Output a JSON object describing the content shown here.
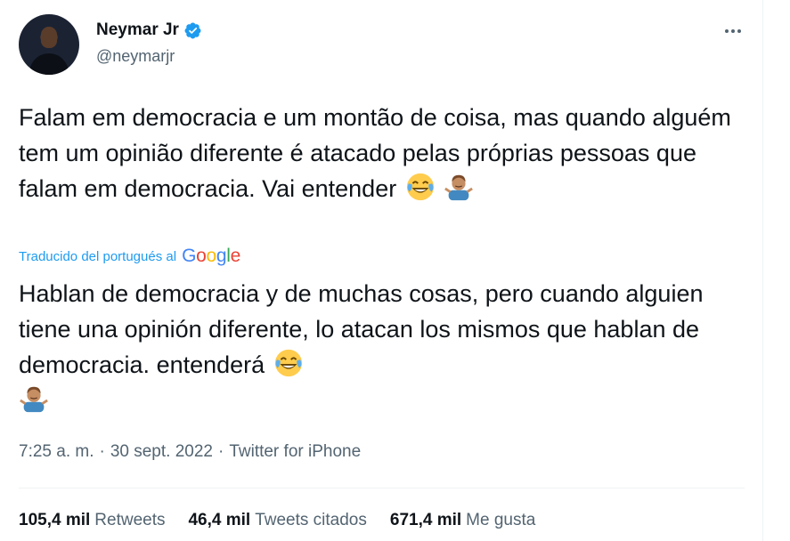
{
  "author": {
    "display_name": "Neymar Jr",
    "handle": "@neymarjr",
    "verified": true
  },
  "tweet": {
    "text": "Falam em democracia e um montão de coisa, mas quando alguém tem um opinião diferente é atacado pelas próprias pessoas que falam em democracia. Vai entender",
    "emojis": [
      "face-with-tears-of-joy",
      "person-shrugging"
    ]
  },
  "translation": {
    "label": "Traducido del portugués al",
    "provider": "Google",
    "text": "Hablan de democracia y de muchas cosas, pero cuando alguien tiene una opinión diferente, lo atacan los mismos que hablan de democracia. entenderá"
  },
  "meta": {
    "time": "7:25 a. m.",
    "separator": "·",
    "date": "30 sept. 2022",
    "source": "Twitter for iPhone"
  },
  "stats": [
    {
      "count": "105,4 mil",
      "label": "Retweets"
    },
    {
      "count": "46,4 mil",
      "label": "Tweets citados"
    },
    {
      "count": "671,4 mil",
      "label": "Me gusta"
    }
  ],
  "colors": {
    "accent": "#1d9bf0",
    "secondary_text": "#536471",
    "primary_text": "#0f1419"
  }
}
